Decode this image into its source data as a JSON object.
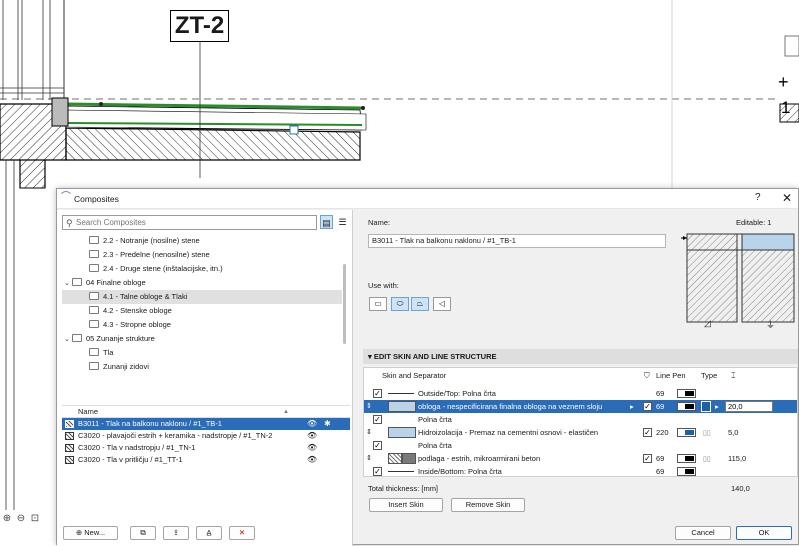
{
  "cad": {
    "marker_label": "ZT-2",
    "level_plus": "+",
    "level_number": "1"
  },
  "dialog": {
    "title": "Composites",
    "help": "?",
    "close": "✕"
  },
  "left": {
    "search_placeholder": "Search Composites",
    "tree": [
      {
        "label": "2.2 - Notranje (nosilne) stene",
        "level": 2
      },
      {
        "label": "2.3 - Predelne (nenosilne) stene",
        "level": 2
      },
      {
        "label": "2.4 - Druge stene (inštalacijske, itn.)",
        "level": 2
      },
      {
        "label": "04 Finalne obloge",
        "level": 1,
        "expanded": true
      },
      {
        "label": "4.1 - Talne obloge & Tlaki",
        "level": 2,
        "selected": true
      },
      {
        "label": "4.2 - Stenske obloge",
        "level": 2
      },
      {
        "label": "4.3 - Stropne obloge",
        "level": 2
      },
      {
        "label": "05 Zunanje strukture",
        "level": 1,
        "expanded": true
      },
      {
        "label": "Tla",
        "level": 2
      },
      {
        "label": "Zunanji zidovi",
        "level": 2
      }
    ],
    "list_header": "Name",
    "list": [
      {
        "name": "B3011 - Tlak na balkonu naklonu  / #1_TB-1",
        "selected": true
      },
      {
        "name": "C3020 - plavajoči estrih + keramika - nadstropje / #1_TN-2"
      },
      {
        "name": "C3020 - Tla v nadstropju / #1_TN-1"
      },
      {
        "name": "C3020 - Tla v pritličju / #1_TT-1"
      }
    ],
    "new_button": "New..."
  },
  "right": {
    "name_label": "Name:",
    "editable_label": "Editable: 1",
    "name_value": "B3011 - Tlak na balkonu naklonu  / #1_TB-1",
    "use_with_label": "Use with:",
    "section_title": "EDIT SKIN AND LINE STRUCTURE",
    "headers": {
      "skin": "Skin and Separator",
      "line_pen": "Line Pen",
      "type": "Type"
    },
    "rows": [
      {
        "label": "Outside/Top: Polna črta",
        "kind": "line",
        "pen": "69",
        "checked": true
      },
      {
        "label": "obloga - nespecificirana finalna obloga na veznem sloju",
        "kind": "skin",
        "pen": "69",
        "thickness": "20,0",
        "selected": true,
        "color": "#b9d3ea",
        "pen_color": "#000000"
      },
      {
        "label": "Polna črta",
        "kind": "line",
        "pen": "69",
        "checked": true
      },
      {
        "label": "Hidroizolacija - Premaz na cementni osnovi - elastičen",
        "kind": "skin",
        "pen": "220",
        "thickness": "5,0",
        "color": "#b9d3ea",
        "pen_color": "#1f5ea8"
      },
      {
        "label": "Polna črta",
        "kind": "line",
        "pen": "69",
        "checked": true
      },
      {
        "label": "podlaga - estrih, mikroarmirani beton",
        "kind": "skin",
        "pen": "69",
        "thickness": "115,0",
        "color": "#7a7a7a",
        "pen_color": "#000000"
      },
      {
        "label": "Inside/Bottom: Polna črta",
        "kind": "line",
        "pen": "69",
        "checked": true
      }
    ],
    "total_label": "Total thickness: [mm]",
    "total_value": "140,0",
    "insert_skin": "Insert Skin",
    "remove_skin": "Remove Skin",
    "cancel": "Cancel",
    "ok": "OK"
  }
}
